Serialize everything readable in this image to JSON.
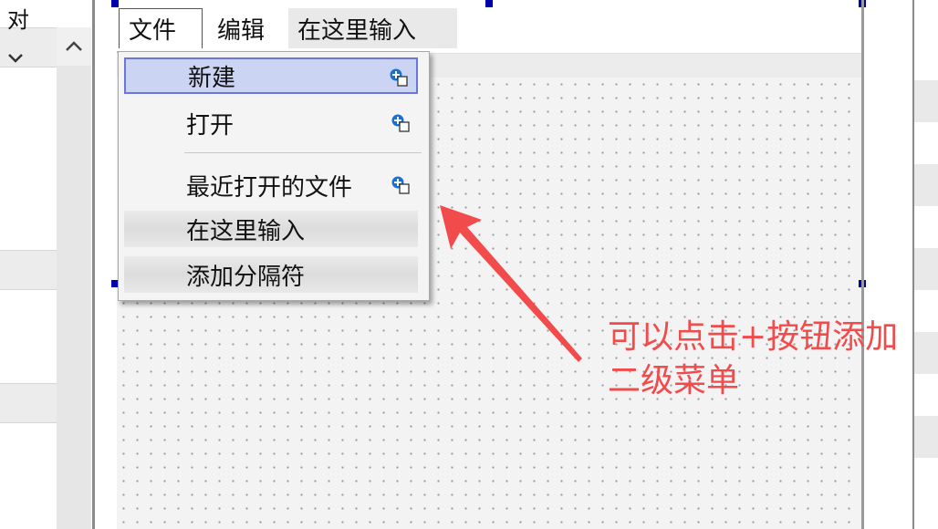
{
  "menubar": {
    "file": "文件",
    "edit": "编辑",
    "type_here": "在这里输入"
  },
  "dropdown": {
    "items": [
      {
        "label": "新建",
        "icon": "submenu-icon"
      },
      {
        "label": "打开",
        "icon": "submenu-icon"
      },
      {
        "label": "最近打开的文件",
        "icon": "submenu-icon"
      },
      {
        "label": "在这里输入"
      },
      {
        "label": "添加分隔符"
      }
    ]
  },
  "annotation": {
    "line1": "可以点击+按钮添加",
    "line2": "二级菜单",
    "color": "#f24b4b"
  },
  "right_panel": {
    "title": "对",
    "chevron": "✓"
  },
  "left_panel": {
    "scroll_up": "^"
  },
  "colors": {
    "selection_fill": "#ccd4f4",
    "selection_border": "#6a76d8",
    "handle": "#0000aa"
  }
}
